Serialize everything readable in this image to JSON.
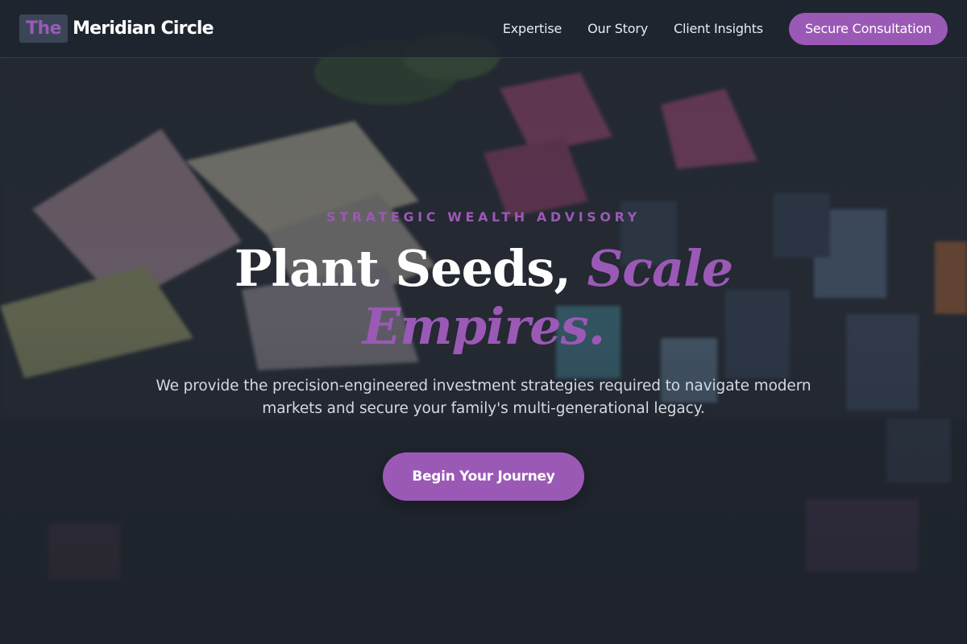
{
  "header": {
    "brand_mark": "The",
    "brand_name": "Meridian Circle",
    "nav": [
      {
        "label": "Expertise"
      },
      {
        "label": "Our Story"
      },
      {
        "label": "Client Insights"
      }
    ],
    "cta_label": "Secure Consultation"
  },
  "hero": {
    "eyebrow": "STRATEGIC WEALTH ADVISORY",
    "headline_plain": "Plant Seeds,",
    "headline_accent": "Scale Empires.",
    "subhead": "We provide the precision-engineered investment strategies required to navigate modern markets and secure your family's multi-generational legacy.",
    "cta_label": "Begin Your Journey",
    "background_image": "blurred photo of money notes, sticky notes and miniature house pieces"
  },
  "colors": {
    "accent": "#9b59b6",
    "header_bg": "#1e242e",
    "page_bg": "#1b2029",
    "text_primary": "#ffffff",
    "text_muted": "#d4d9e1"
  }
}
